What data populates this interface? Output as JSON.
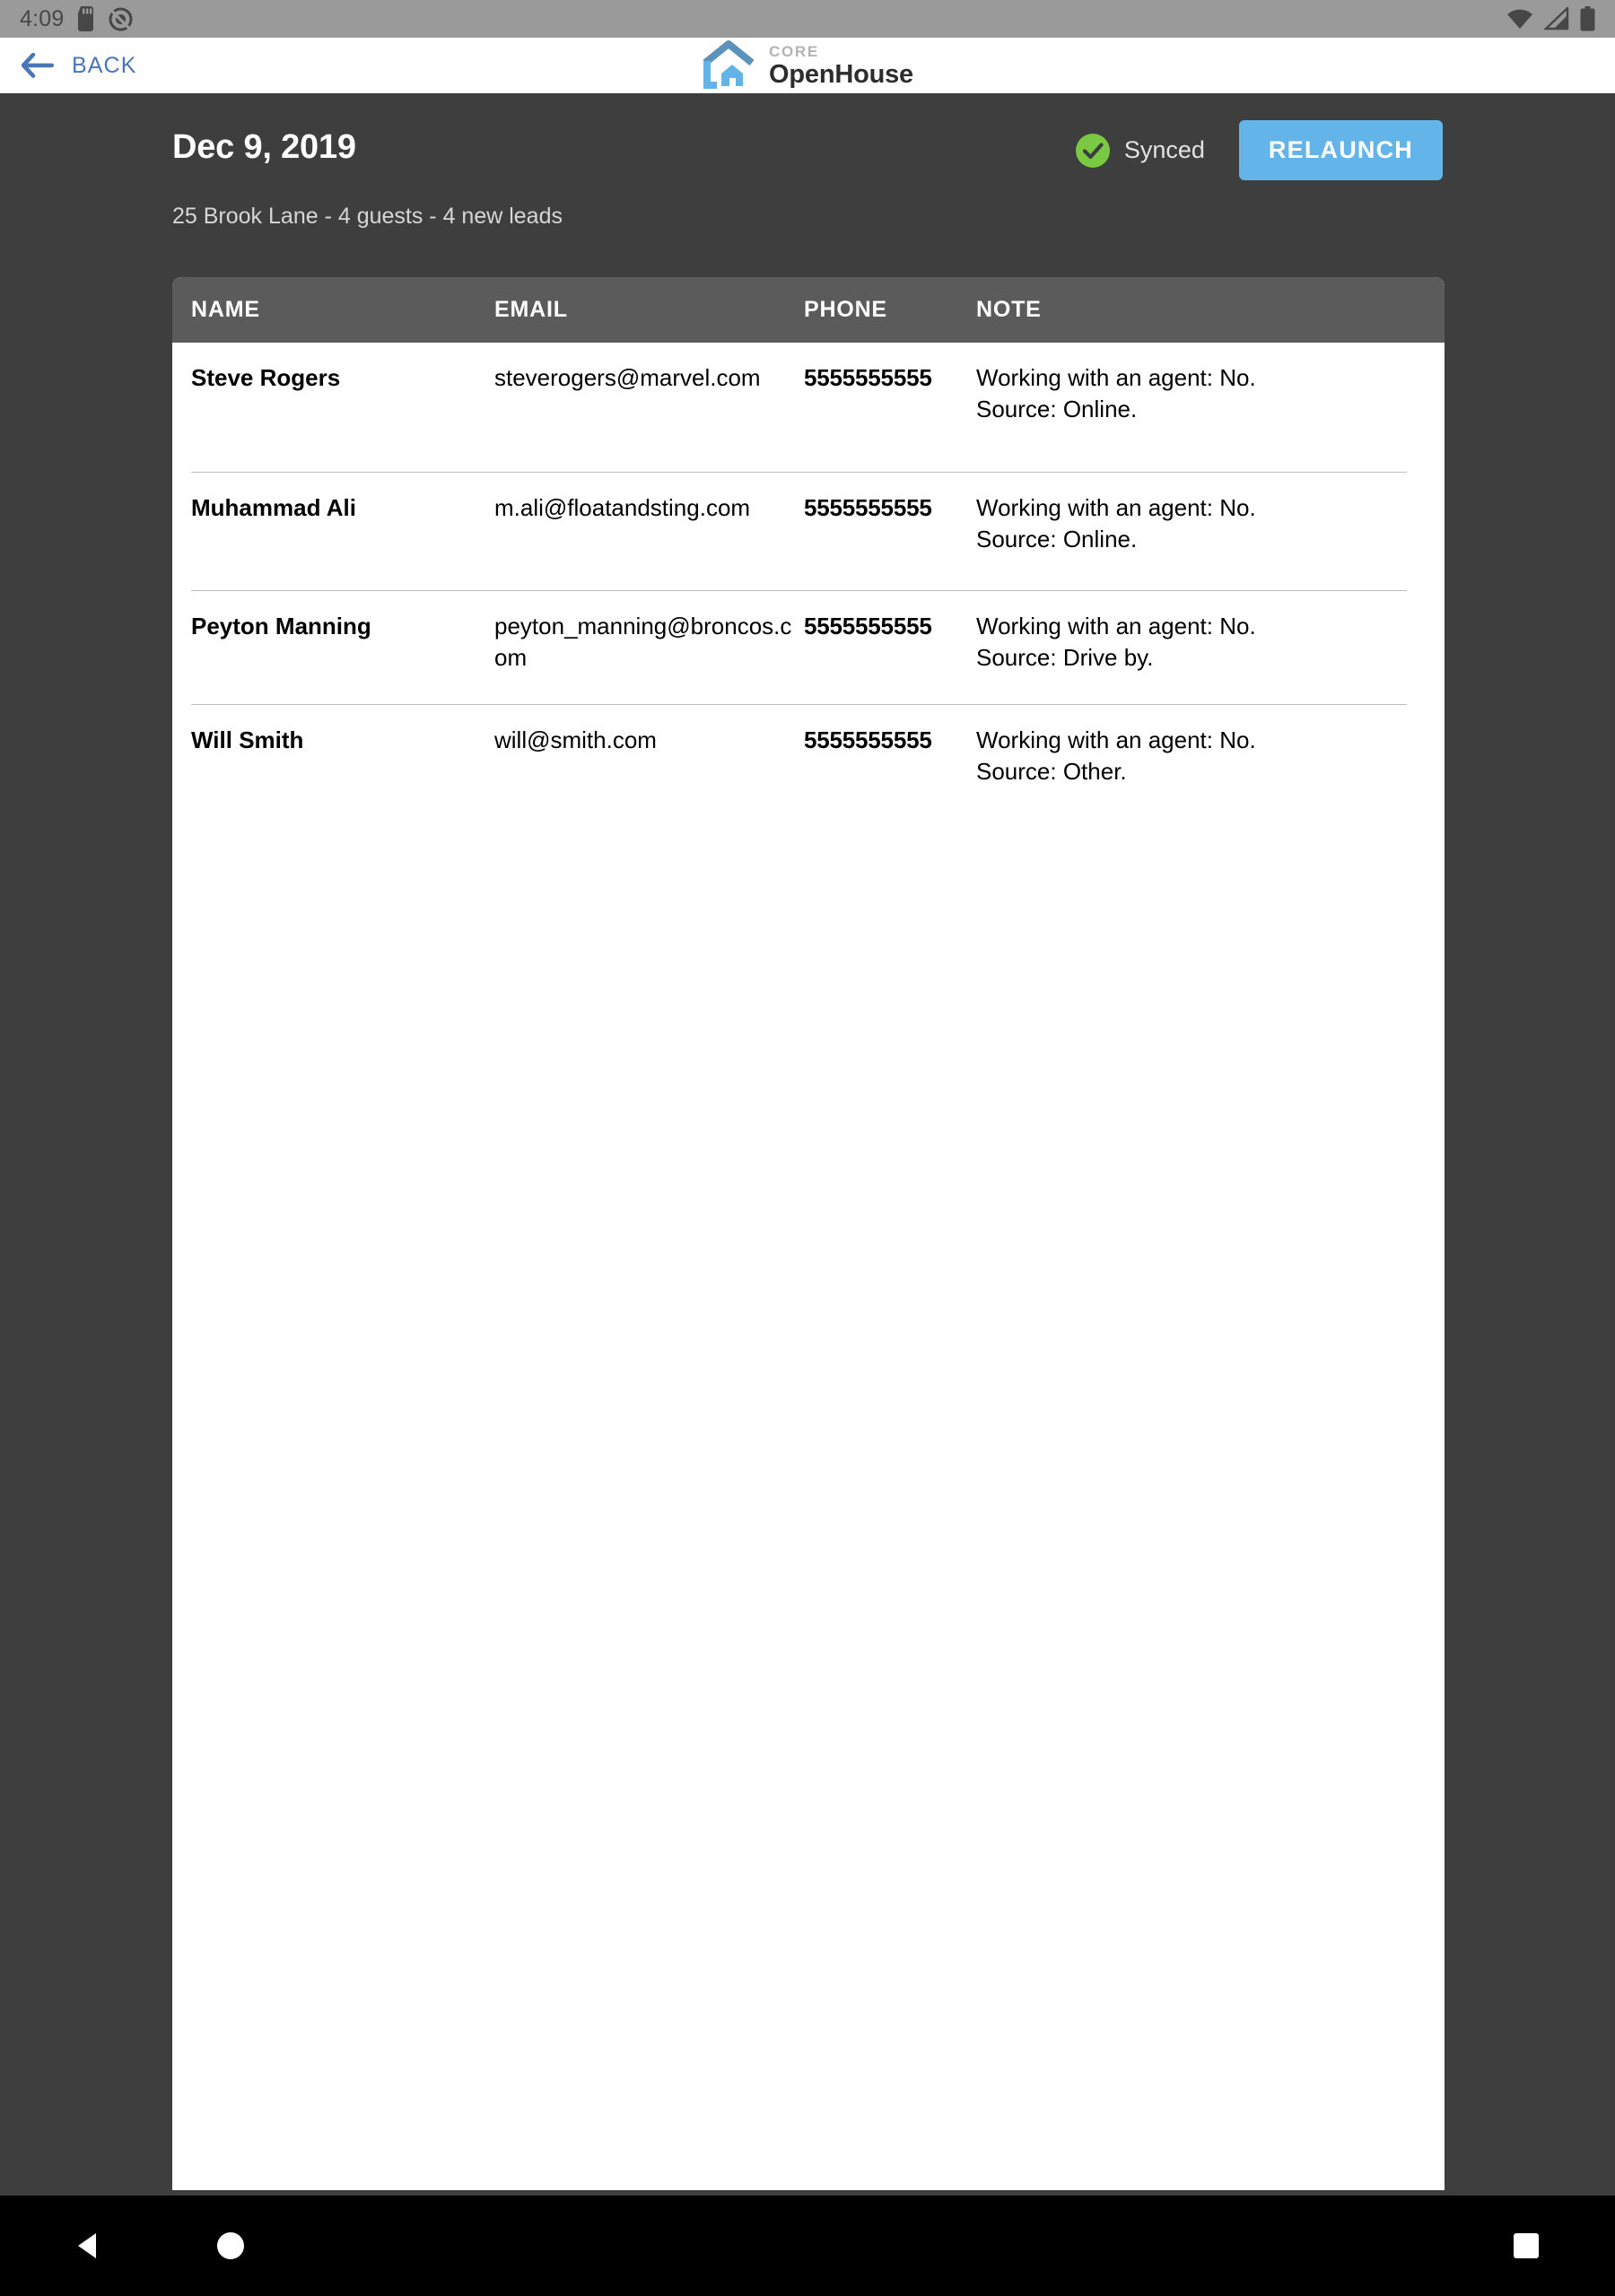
{
  "status_bar": {
    "time": "4:09",
    "left_icons": [
      "sd-card-icon",
      "do-not-disturb-icon"
    ],
    "right_icons": [
      "wifi-icon",
      "cell-signal-icon",
      "battery-icon"
    ]
  },
  "app_bar": {
    "back_label": "BACK",
    "back_icon": "arrow-left-icon",
    "brand_top": "CORE",
    "brand_name": "OpenHouse",
    "brand_icon": "house-logo-icon",
    "accent_blue": "#4a76b8"
  },
  "header": {
    "title": "Dec 9, 2019",
    "subtitle": "25 Brook Lane - 4 guests - 4 new leads",
    "sync_label": "Synced",
    "sync_icon": "check-circle-icon",
    "sync_color": "#7ac943",
    "relaunch_label": "RELAUNCH",
    "relaunch_color": "#63b4e8"
  },
  "table": {
    "columns": [
      "NAME",
      "EMAIL",
      "PHONE",
      "NOTE"
    ],
    "rows": [
      {
        "name": "Steve Rogers",
        "email": "steverogers@marvel.com",
        "phone": "5555555555",
        "note": "Working with an agent: No.\nSource: Online."
      },
      {
        "name": "Muhammad Ali",
        "email": "m.ali@floatandsting.com",
        "phone": "5555555555",
        "note": "Working with an agent: No.\nSource: Online."
      },
      {
        "name": "Peyton Manning",
        "email": "peyton_manning@broncos.com",
        "phone": "5555555555",
        "note": "Working with an agent: No.\nSource: Drive by."
      },
      {
        "name": "Will Smith",
        "email": "will@smith.com",
        "phone": "5555555555",
        "note": "Working with an agent: No.\nSource: Other."
      }
    ]
  },
  "nav_bar": {
    "back_icon": "triangle-back-icon",
    "home_icon": "circle-home-icon",
    "recent_icon": "square-recents-icon"
  }
}
